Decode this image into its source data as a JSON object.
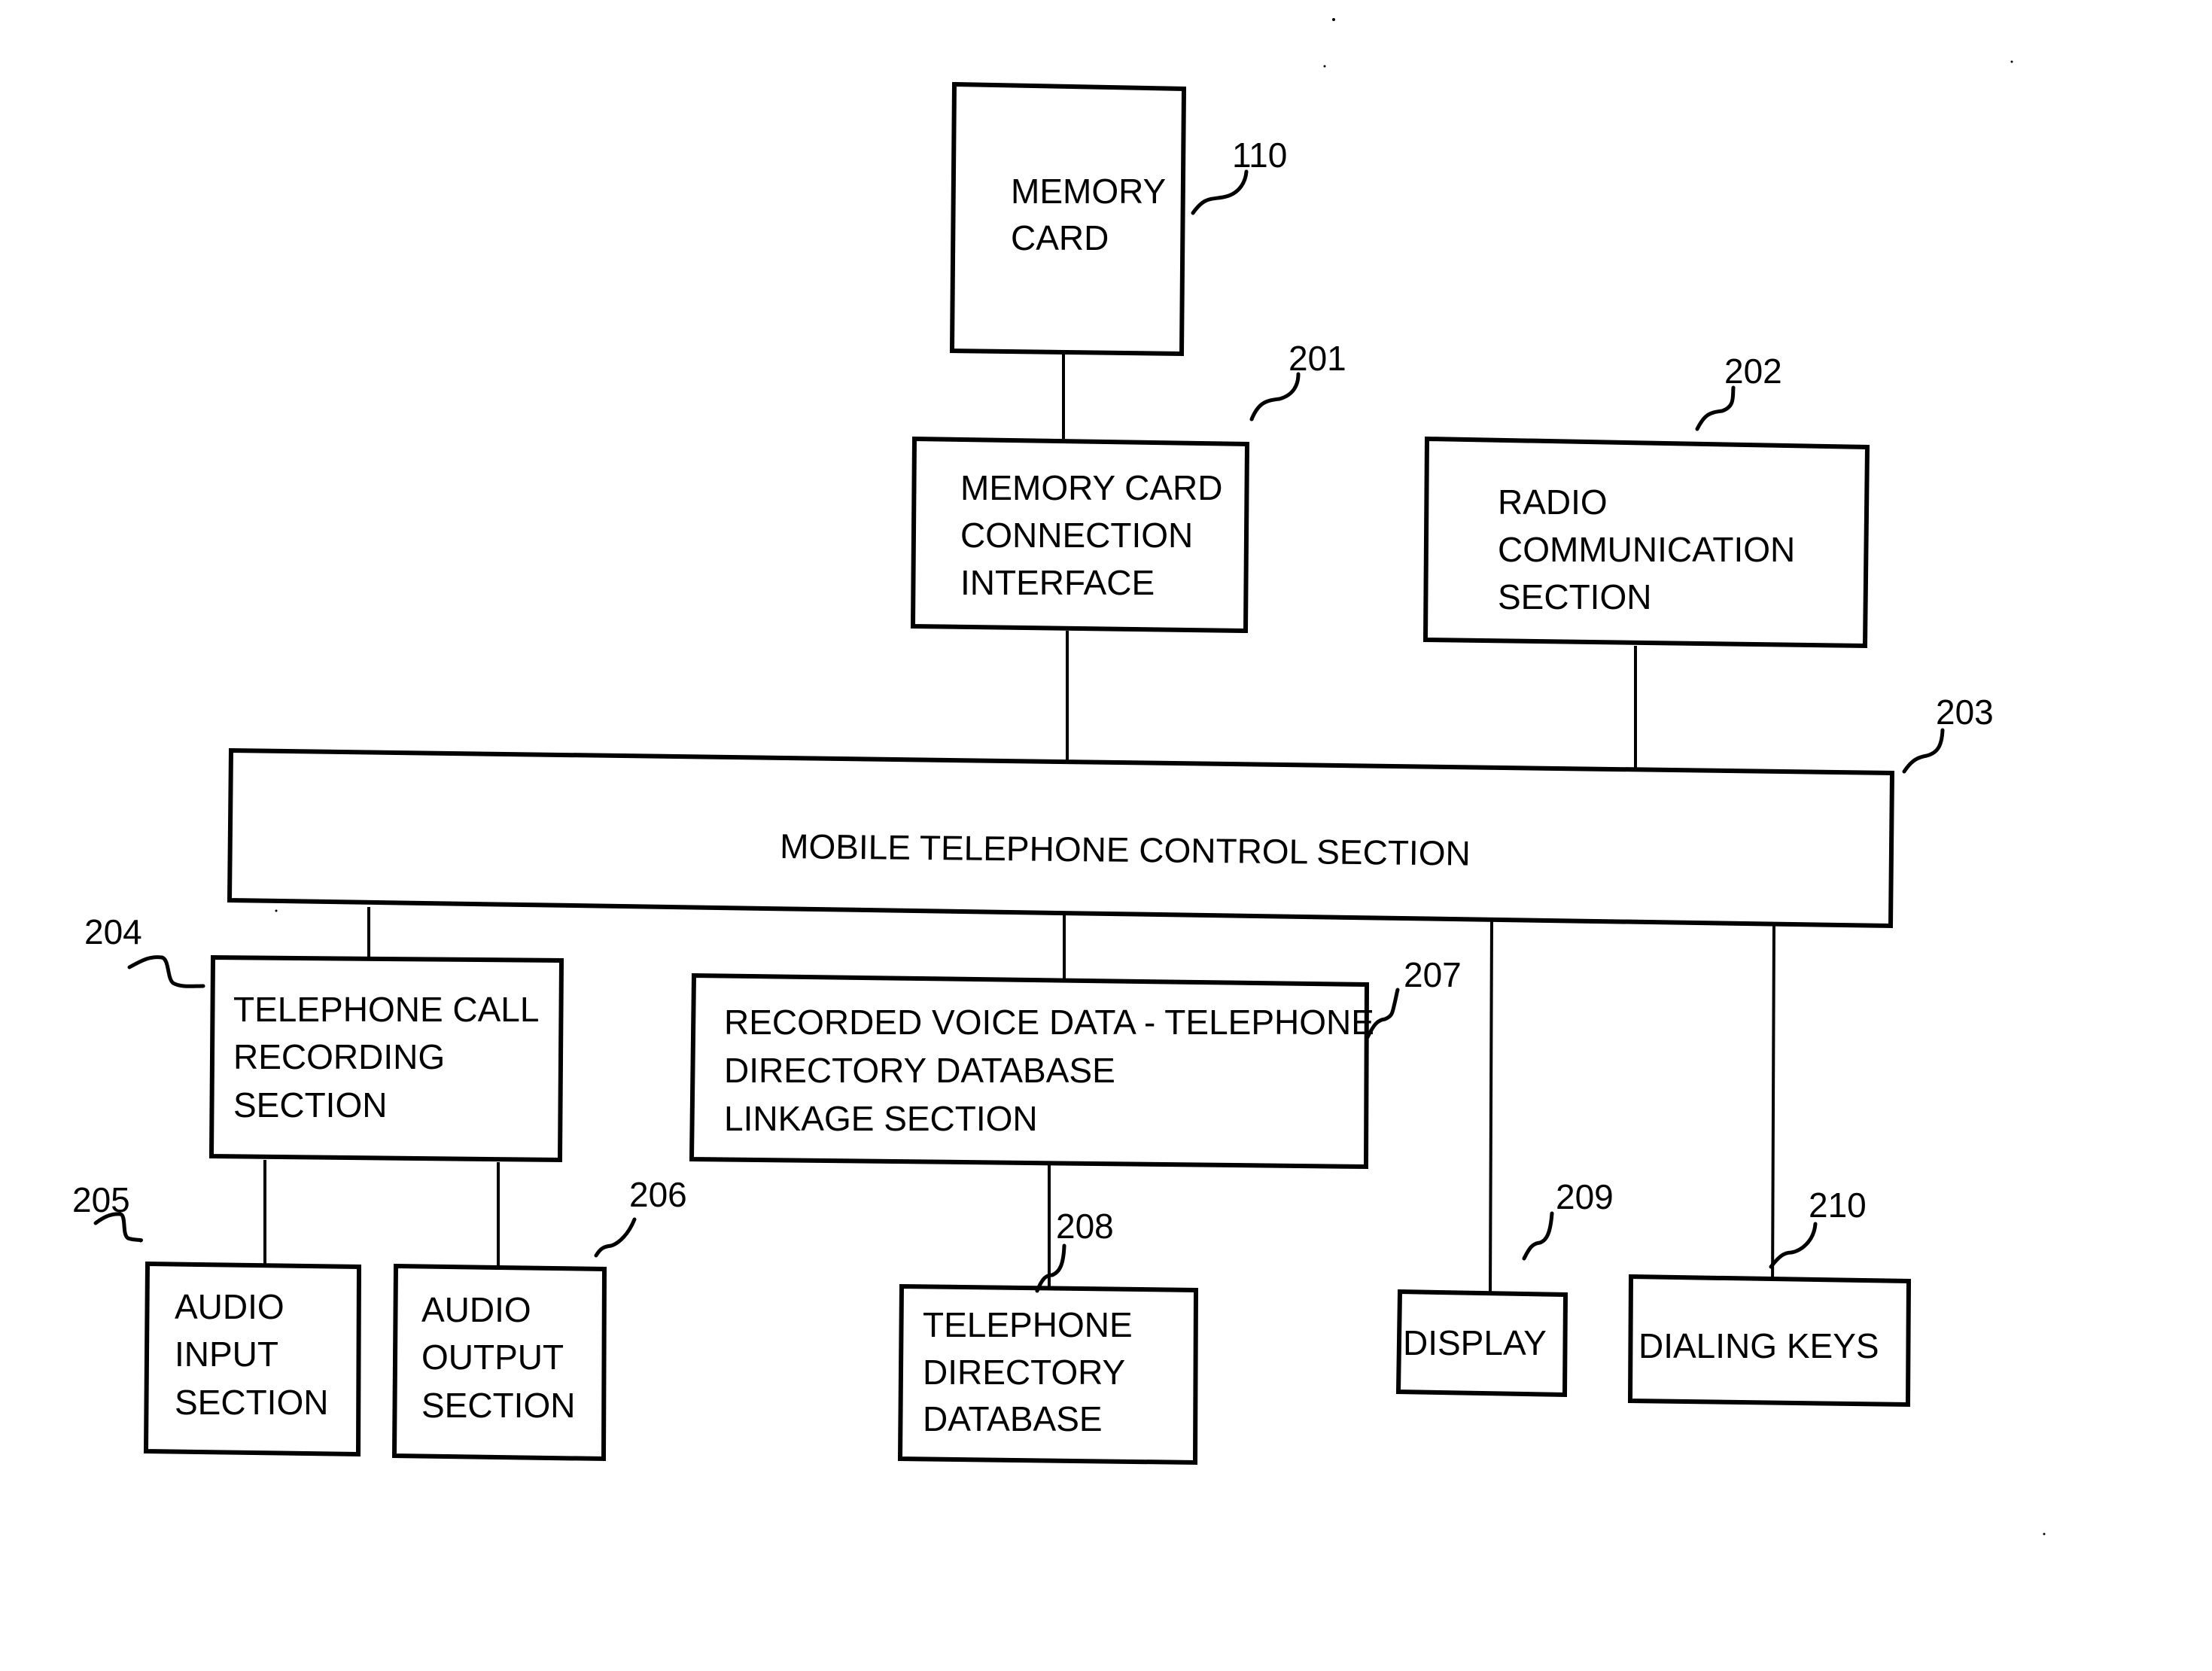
{
  "diagram": {
    "blocks": {
      "memory_card": {
        "ref": "110",
        "lines": [
          "MEMORY",
          "CARD"
        ]
      },
      "card_interface": {
        "ref": "201",
        "lines": [
          "MEMORY CARD",
          "CONNECTION",
          "INTERFACE"
        ]
      },
      "radio": {
        "ref": "202",
        "lines": [
          "RADIO",
          "COMMUNICATION",
          "SECTION"
        ]
      },
      "control": {
        "ref": "203",
        "lines": [
          "MOBILE TELEPHONE CONTROL SECTION"
        ]
      },
      "call_recording": {
        "ref": "204",
        "lines": [
          "TELEPHONE CALL",
          "RECORDING",
          "SECTION"
        ]
      },
      "audio_input": {
        "ref": "205",
        "lines": [
          "AUDIO",
          "INPUT",
          "SECTION"
        ]
      },
      "audio_output": {
        "ref": "206",
        "lines": [
          "AUDIO",
          "OUTPUT",
          "SECTION"
        ]
      },
      "linkage": {
        "ref": "207",
        "lines": [
          "RECORDED VOICE DATA - TELEPHONE",
          "DIRECTORY DATABASE",
          "LINKAGE SECTION"
        ]
      },
      "directory_db": {
        "ref": "208",
        "lines": [
          "TELEPHONE",
          "DIRECTORY",
          "DATABASE"
        ]
      },
      "display": {
        "ref": "209",
        "lines": [
          "DISPLAY"
        ]
      },
      "dialing_keys": {
        "ref": "210",
        "lines": [
          "DIALING KEYS"
        ]
      }
    },
    "connections": [
      [
        "memory_card",
        "card_interface"
      ],
      [
        "card_interface",
        "control"
      ],
      [
        "radio",
        "control"
      ],
      [
        "control",
        "call_recording"
      ],
      [
        "control",
        "linkage"
      ],
      [
        "control",
        "display"
      ],
      [
        "control",
        "dialing_keys"
      ],
      [
        "call_recording",
        "audio_input"
      ],
      [
        "call_recording",
        "audio_output"
      ],
      [
        "linkage",
        "directory_db"
      ]
    ]
  }
}
